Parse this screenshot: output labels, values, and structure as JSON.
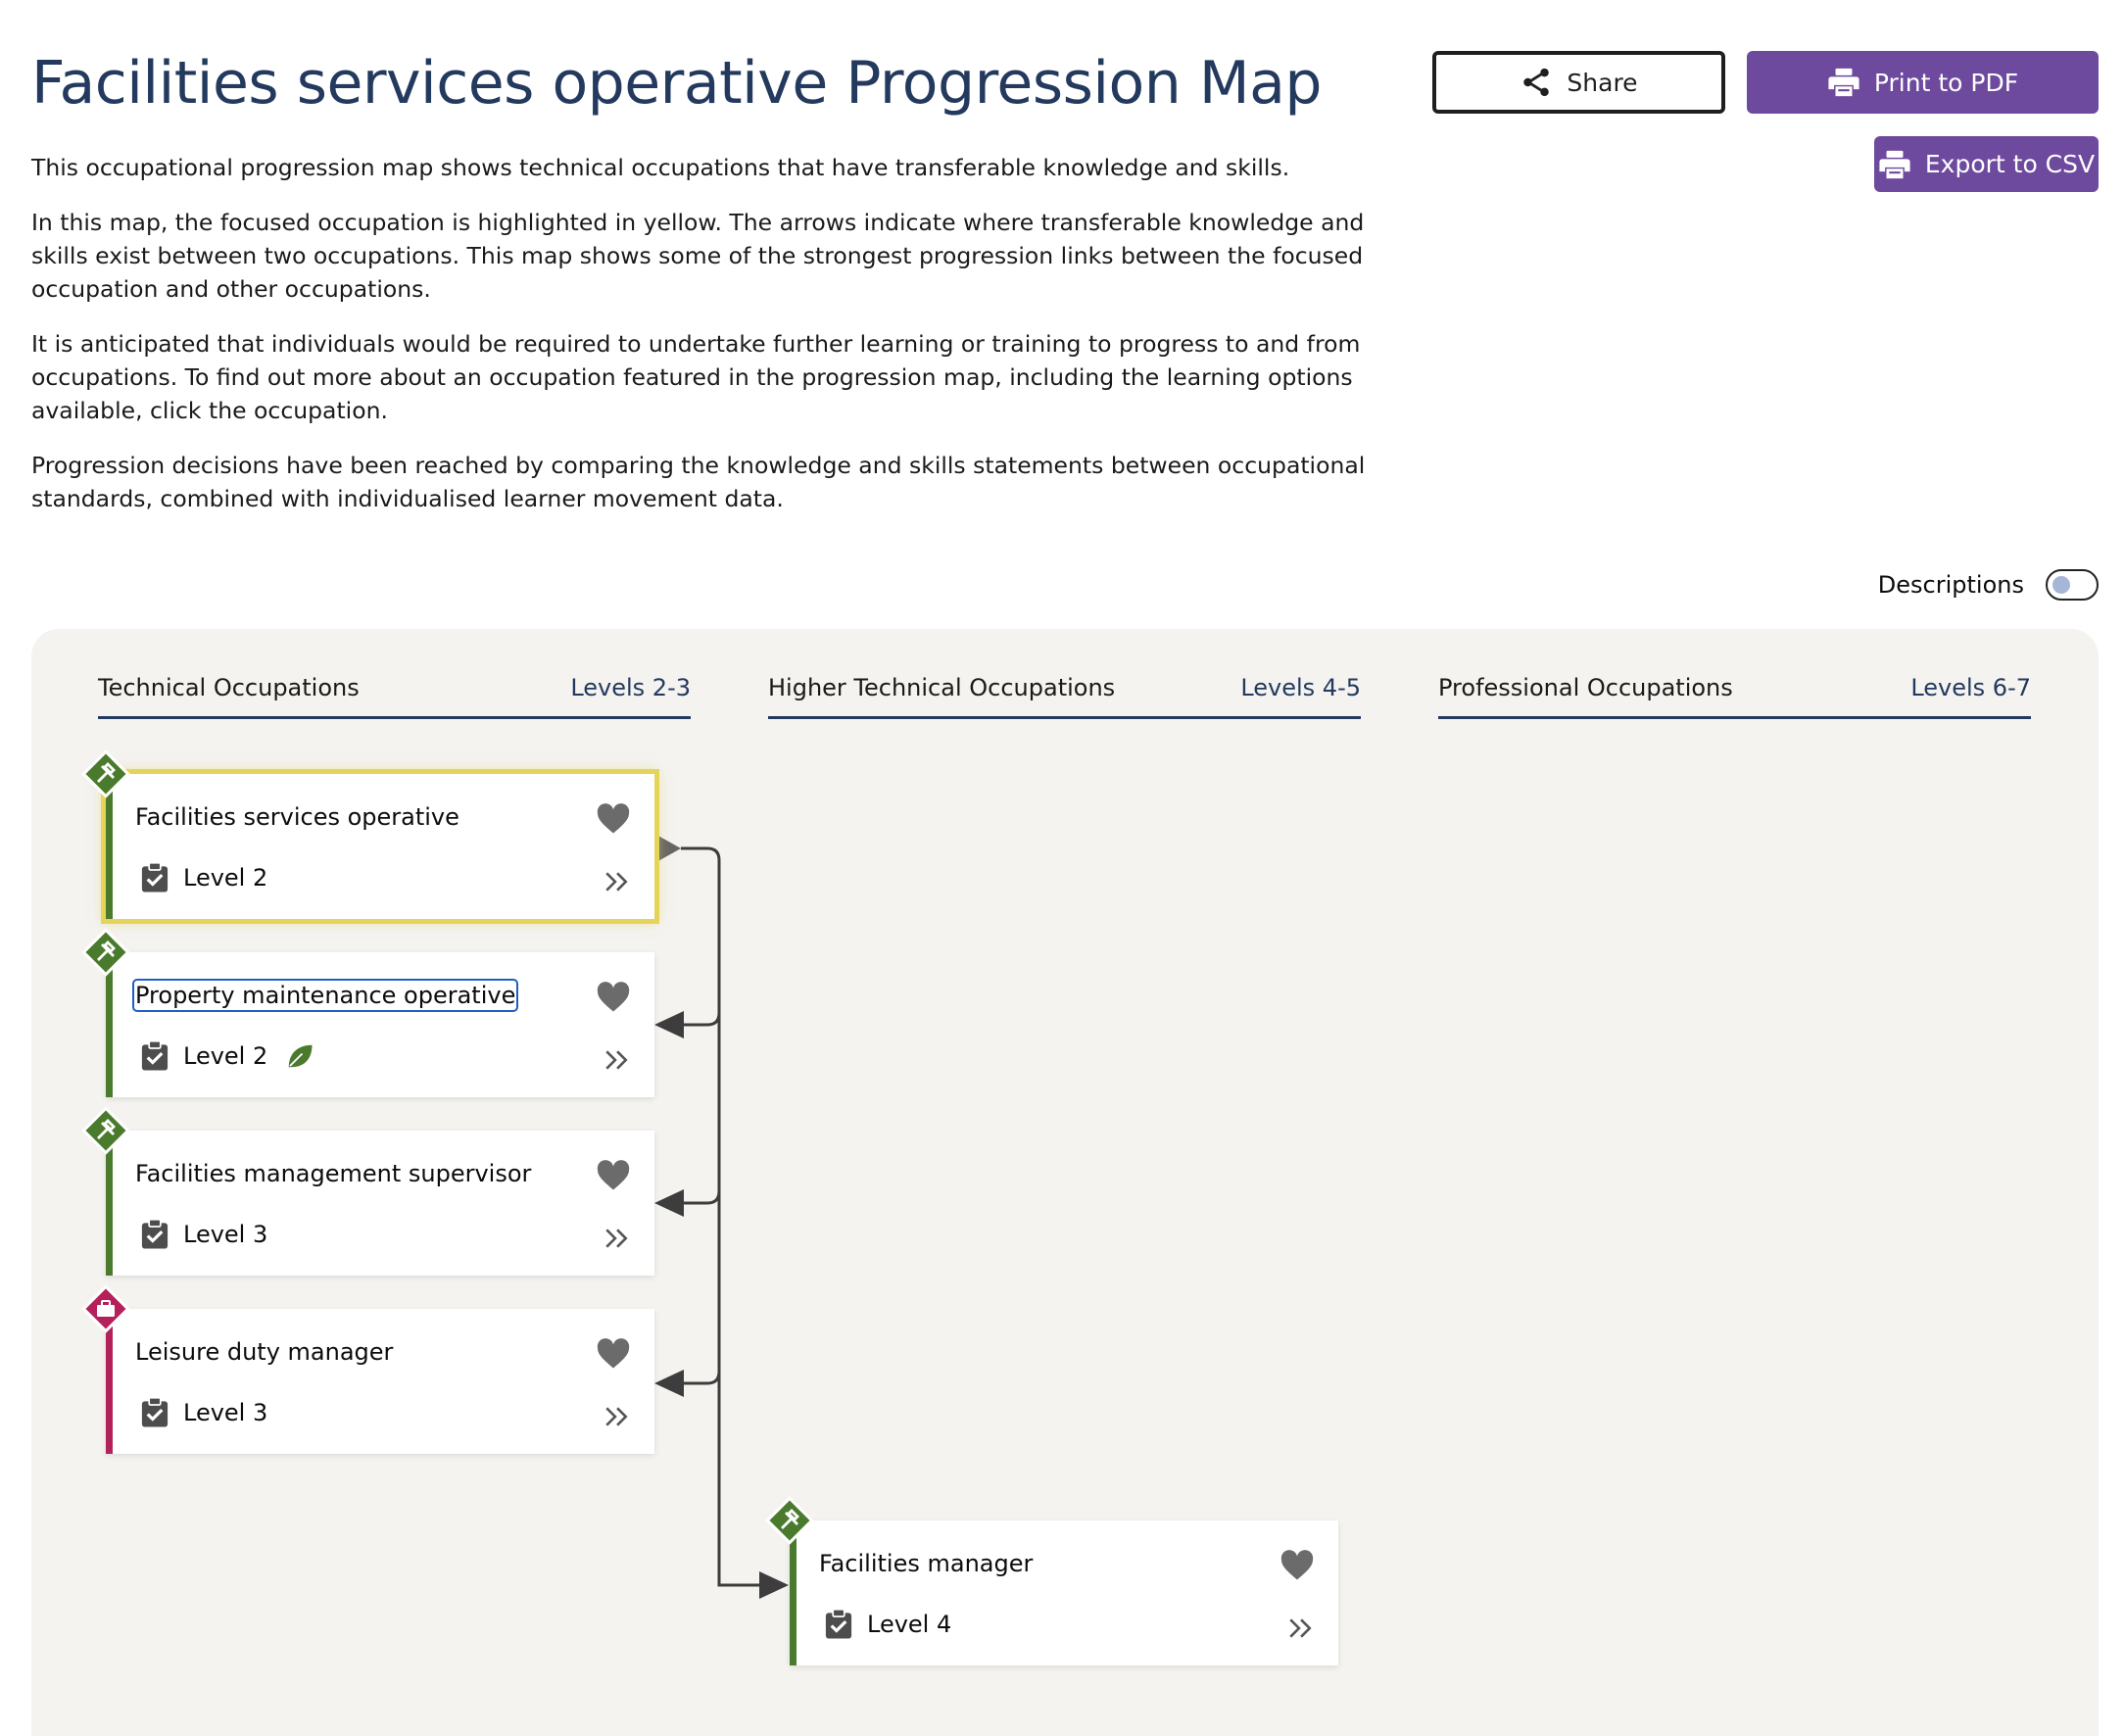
{
  "page": {
    "title": "Facilities services operative Progression Map",
    "intro": [
      "This occupational progression map shows technical occupations that have transferable knowledge and skills.",
      "In this map, the focused occupation is highlighted in yellow. The arrows indicate where transferable knowledge and skills exist between two occupations. This map shows some of the strongest progression links between the focused occupation and other occupations.",
      "It is anticipated that individuals would be required to undertake further learning or training to progress to and from occupations. To find out more about an occupation featured in the progression map, including the learning options available, click the occupation.",
      "Progression decisions have been reached by comparing the knowledge and skills statements between occupational standards, combined with individualised learner movement data."
    ]
  },
  "toolbar": {
    "share_label": "Share",
    "print_label": "Print to PDF",
    "csv_label": "Export to CSV"
  },
  "descriptions_toggle": {
    "label": "Descriptions",
    "on": false
  },
  "columns": [
    {
      "name": "Technical Occupations",
      "levels": "Levels 2-3"
    },
    {
      "name": "Higher Technical Occupations",
      "levels": "Levels 4-5"
    },
    {
      "name": "Professional Occupations",
      "levels": "Levels 6-7"
    }
  ],
  "occupations": [
    {
      "name": "Facilities services operative",
      "level": "Level 2",
      "route": "construction",
      "focused": true,
      "green": false
    },
    {
      "name": "Property maintenance operative",
      "level": "Level 2",
      "route": "construction",
      "focused": false,
      "green": true
    },
    {
      "name": "Facilities management supervisor",
      "level": "Level 3",
      "route": "construction",
      "focused": false,
      "green": false
    },
    {
      "name": "Leisure duty manager",
      "level": "Level 3",
      "route": "business",
      "focused": false,
      "green": false
    },
    {
      "name": "Facilities manager",
      "level": "Level 4",
      "route": "construction",
      "focused": false,
      "green": false
    }
  ],
  "colors": {
    "title": "#233a5e",
    "accent_purple": "#6e4a9e",
    "route_construction": "#4a7a2c",
    "route_business": "#b4205a",
    "focus_highlight": "#e4d45c",
    "panel": "#f4f3f0"
  },
  "icons": {
    "share": "share-icon",
    "print": "printer-icon",
    "level": "clipboard-check-icon",
    "favourite": "heart-icon",
    "open": "double-chevron-right-icon",
    "green_skills": "leaf-icon",
    "construction_route": "hammer-wrench-icon",
    "business_route": "briefcase-icon"
  }
}
